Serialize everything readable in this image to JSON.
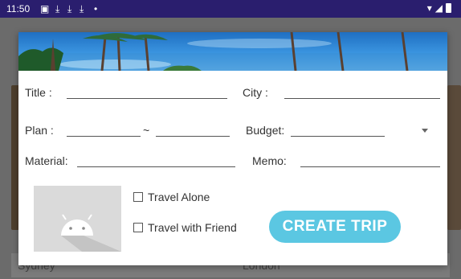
{
  "status_bar": {
    "time": "11:50",
    "notification_icons": [
      "notification-a-icon",
      "download-icon",
      "download-icon",
      "download-icon",
      "dot-icon"
    ],
    "system_icons": [
      "wifi-icon",
      "cell-signal-icon",
      "battery-icon"
    ]
  },
  "background": {
    "left_label": "Sydney",
    "right_label": "London"
  },
  "dialog": {
    "title_label": "Title :",
    "city_label": "City :",
    "plan_label": "Plan :",
    "plan_separator": "~",
    "budget_label": "Budget:",
    "material_label": "Material:",
    "memo_label": "Memo:",
    "travel_alone_label": "Travel Alone",
    "travel_with_friend_label": "Travel with Friend",
    "create_trip_label": "CREATE TRIP"
  },
  "colors": {
    "status_bar": "#2a1e6e",
    "button": "#5bc7e2",
    "scrim": "#6b6b6b"
  }
}
